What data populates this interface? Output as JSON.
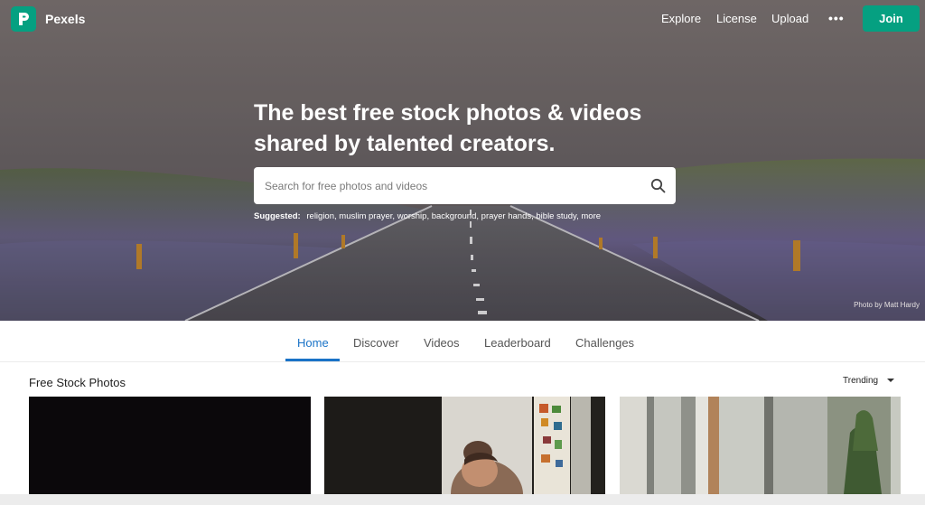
{
  "header": {
    "brand": "Pexels",
    "nav": [
      "Explore",
      "License",
      "Upload"
    ],
    "more": "•••",
    "join": "Join"
  },
  "hero": {
    "headline_line1": "The best free stock photos & videos",
    "headline_line2": "shared by talented creators.",
    "search_placeholder": "Search for free photos and videos",
    "suggested_label": "Suggested:",
    "suggestions": [
      "religion,",
      "muslim prayer,",
      "worship,",
      "background,",
      "prayer hands,",
      "bible study,",
      "more"
    ],
    "credit": "Photo by Matt Hardy"
  },
  "tabs": [
    "Home",
    "Discover",
    "Videos",
    "Leaderboard",
    "Challenges"
  ],
  "active_tab": "Home",
  "main": {
    "section_title": "Free Stock Photos",
    "sort_label": "Trending"
  },
  "colors": {
    "brand": "#05a081",
    "active_tab": "#1a73c7"
  }
}
